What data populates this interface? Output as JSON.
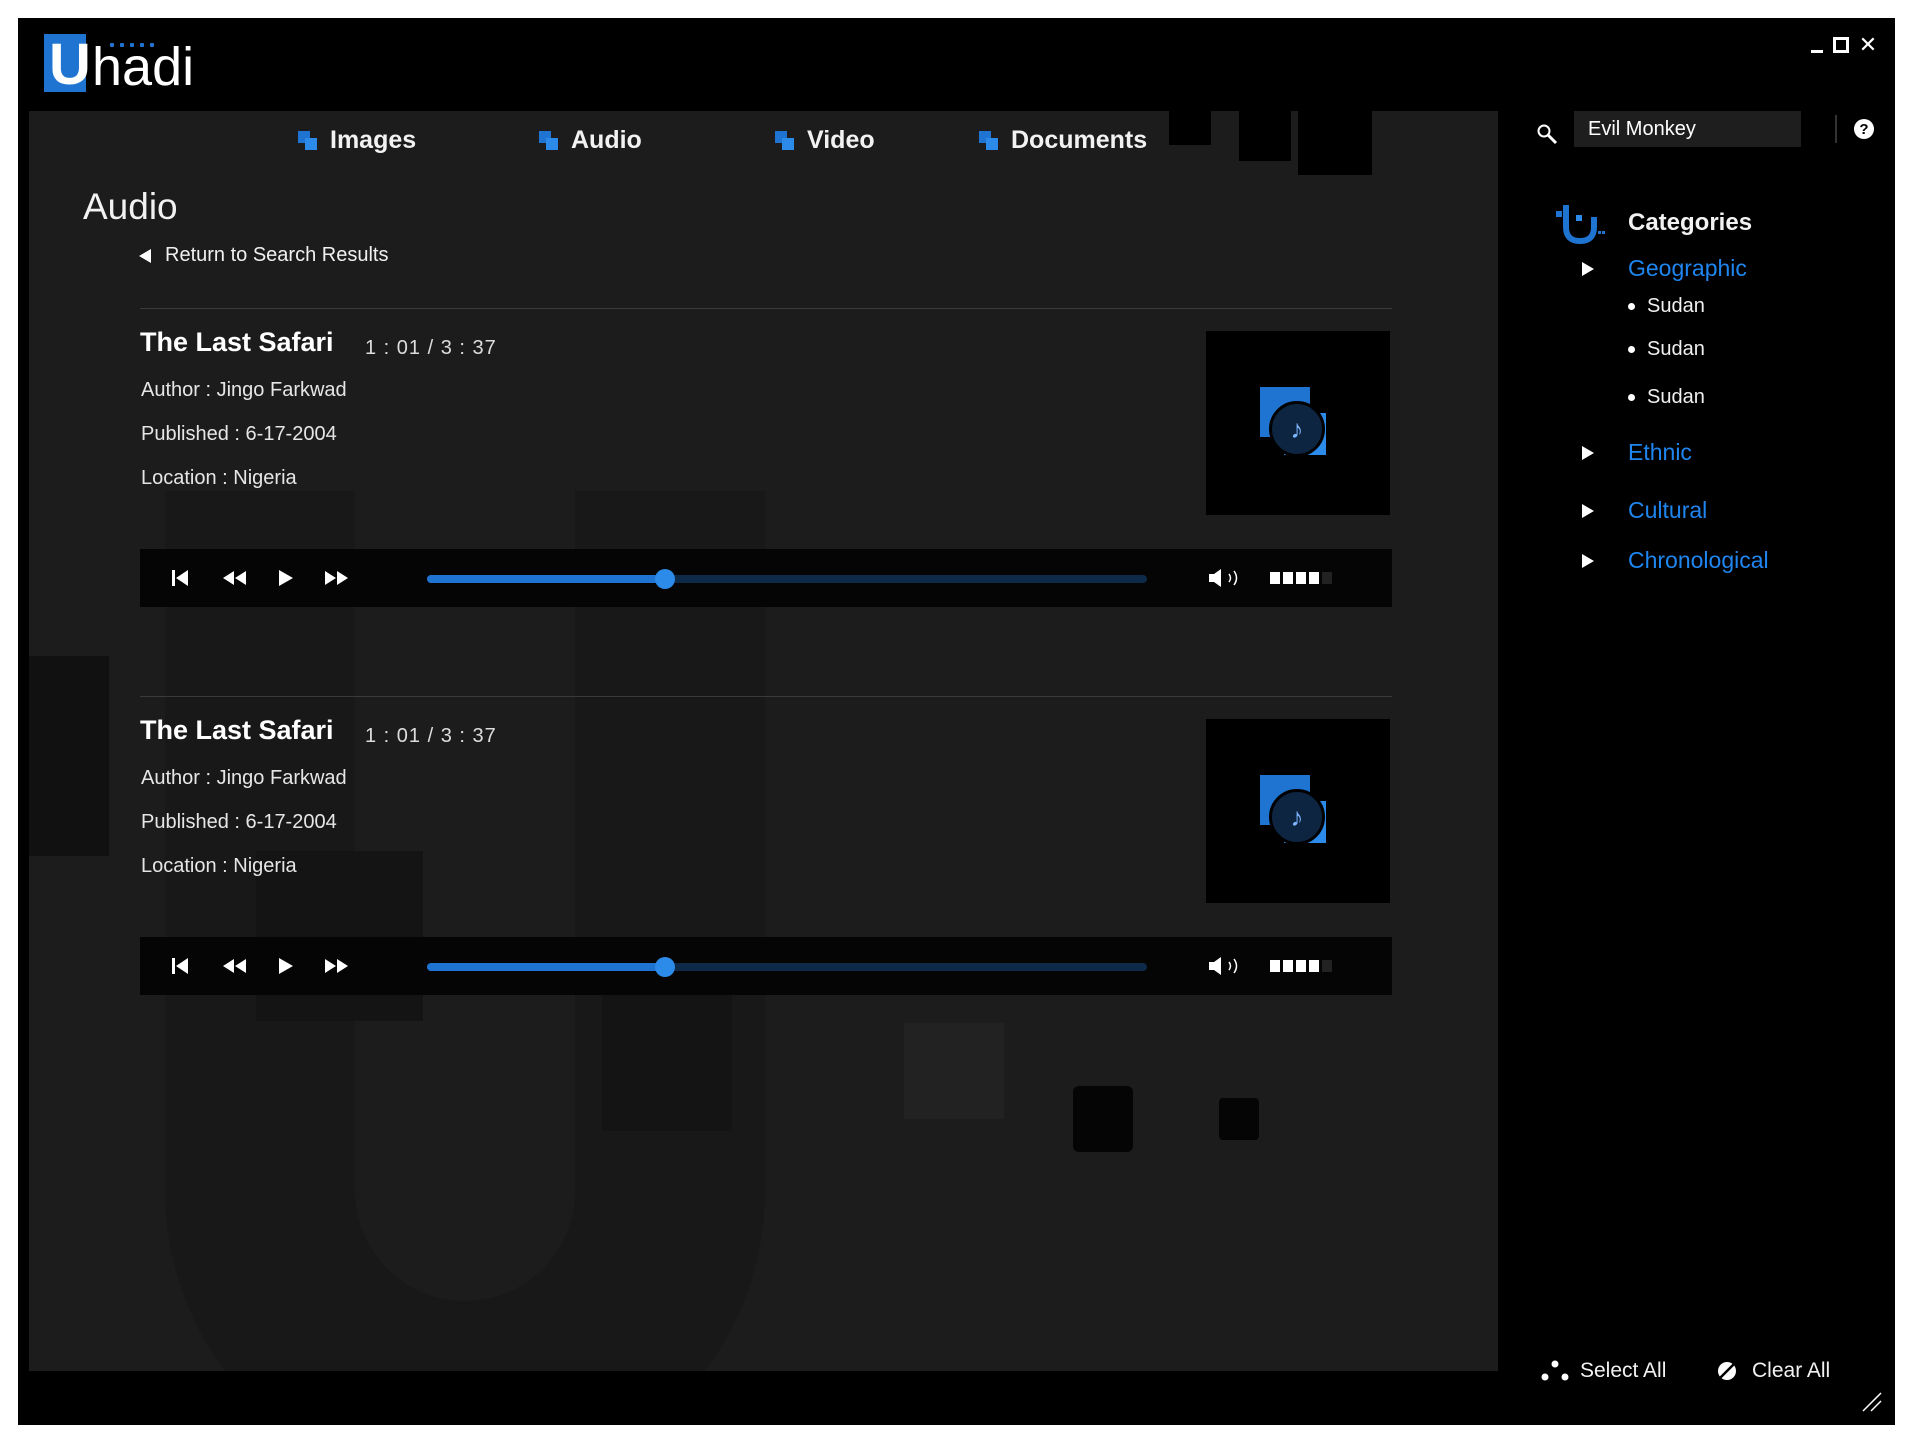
{
  "app": {
    "logo_letter": "U",
    "logo_rest": "hadi"
  },
  "nav": [
    {
      "label": "Images"
    },
    {
      "label": "Audio"
    },
    {
      "label": "Video"
    },
    {
      "label": "Documents"
    }
  ],
  "page": {
    "title": "Audio",
    "back_label": "Return to Search Results"
  },
  "tracks": [
    {
      "title": "The Last Safari",
      "time": "1 : 01  /  3 : 37",
      "author_label": "Author :",
      "author": "Jingo Farkwad",
      "published_label": "Published :",
      "published": "6-17-2004",
      "location_label": "Location :",
      "location": "Nigeria",
      "progress_fraction": 0.33,
      "volume_level": 4,
      "volume_max": 5
    },
    {
      "title": "The Last Safari",
      "time": "1 : 01  /  3 : 37",
      "author_label": "Author :",
      "author": "Jingo Farkwad",
      "published_label": "Published :",
      "published": "6-17-2004",
      "location_label": "Location :",
      "location": "Nigeria",
      "progress_fraction": 0.33,
      "volume_level": 4,
      "volume_max": 5
    }
  ],
  "sidebar": {
    "search_value": "Evil Monkey",
    "categories_title": "Categories",
    "categories": [
      {
        "label": "Geographic",
        "expanded": true,
        "children": [
          "Sudan",
          "Sudan",
          "Sudan"
        ]
      },
      {
        "label": "Ethnic"
      },
      {
        "label": "Cultural"
      },
      {
        "label": "Chronological"
      }
    ],
    "select_all": "Select All",
    "clear_all": "Clear All"
  },
  "colors": {
    "accent": "#1f74d1",
    "link": "#1f86f0",
    "background": "#000000",
    "panel": "#1c1c1c"
  }
}
